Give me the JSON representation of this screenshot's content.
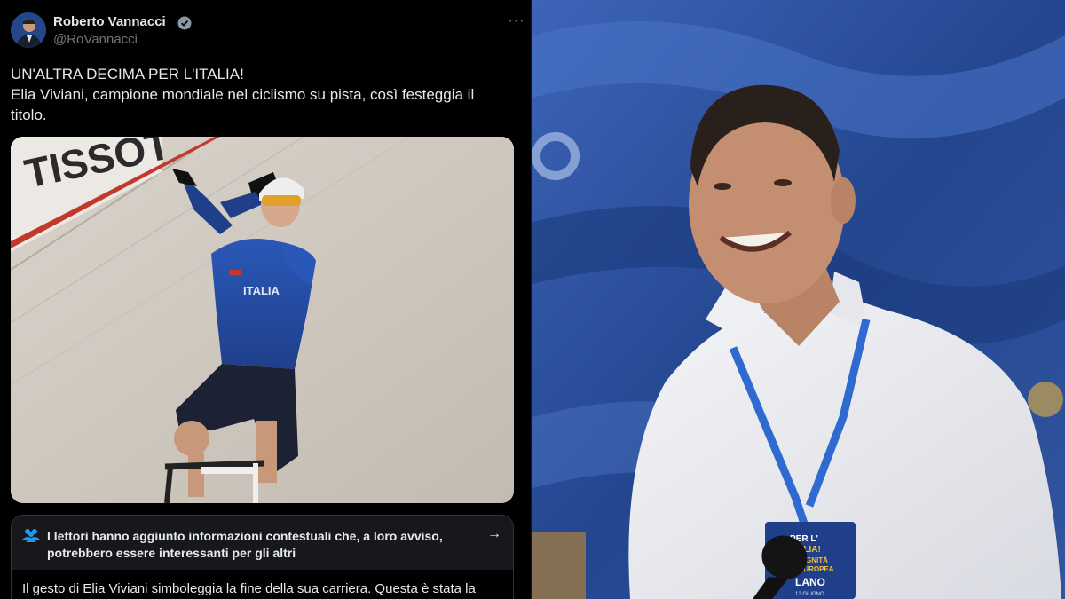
{
  "tweet": {
    "author_name": "Roberto Vannacci",
    "author_handle": "@RoVannacci",
    "more_label": "···",
    "text_line1": "UN'ALTRA DECIMA PER L'ITALIA!",
    "text_line2": "Elia Viviani, campione mondiale nel ciclismo su pista, così festeggia il titolo.",
    "media_sign_text": "TISSOT",
    "jersey_text": "ITALIA",
    "community_note": {
      "title": "I lettori hanno aggiunto informazioni contestuali che, a loro avviso, potrebbero essere interessanti per gli altri",
      "body": "Il gesto di Elia Viviani simboleggia la fine della sua carriera. Questa è stata la"
    }
  },
  "photo": {
    "badge_line1": "PER L'",
    "badge_line2": "ITALIA!",
    "badge_line3": "DIGNITÀ",
    "badge_line4": "EUROPEA",
    "badge_city": "LANO",
    "badge_sub": "12 GIUGNO"
  },
  "colors": {
    "verified": "#8b98a5",
    "tweet_bg": "#000000",
    "text": "#e7e9ea",
    "muted": "#71767b",
    "note_header_bg": "#16181c",
    "photo_bg": "#2c4f9c",
    "lanyard": "#2f6ad1"
  }
}
